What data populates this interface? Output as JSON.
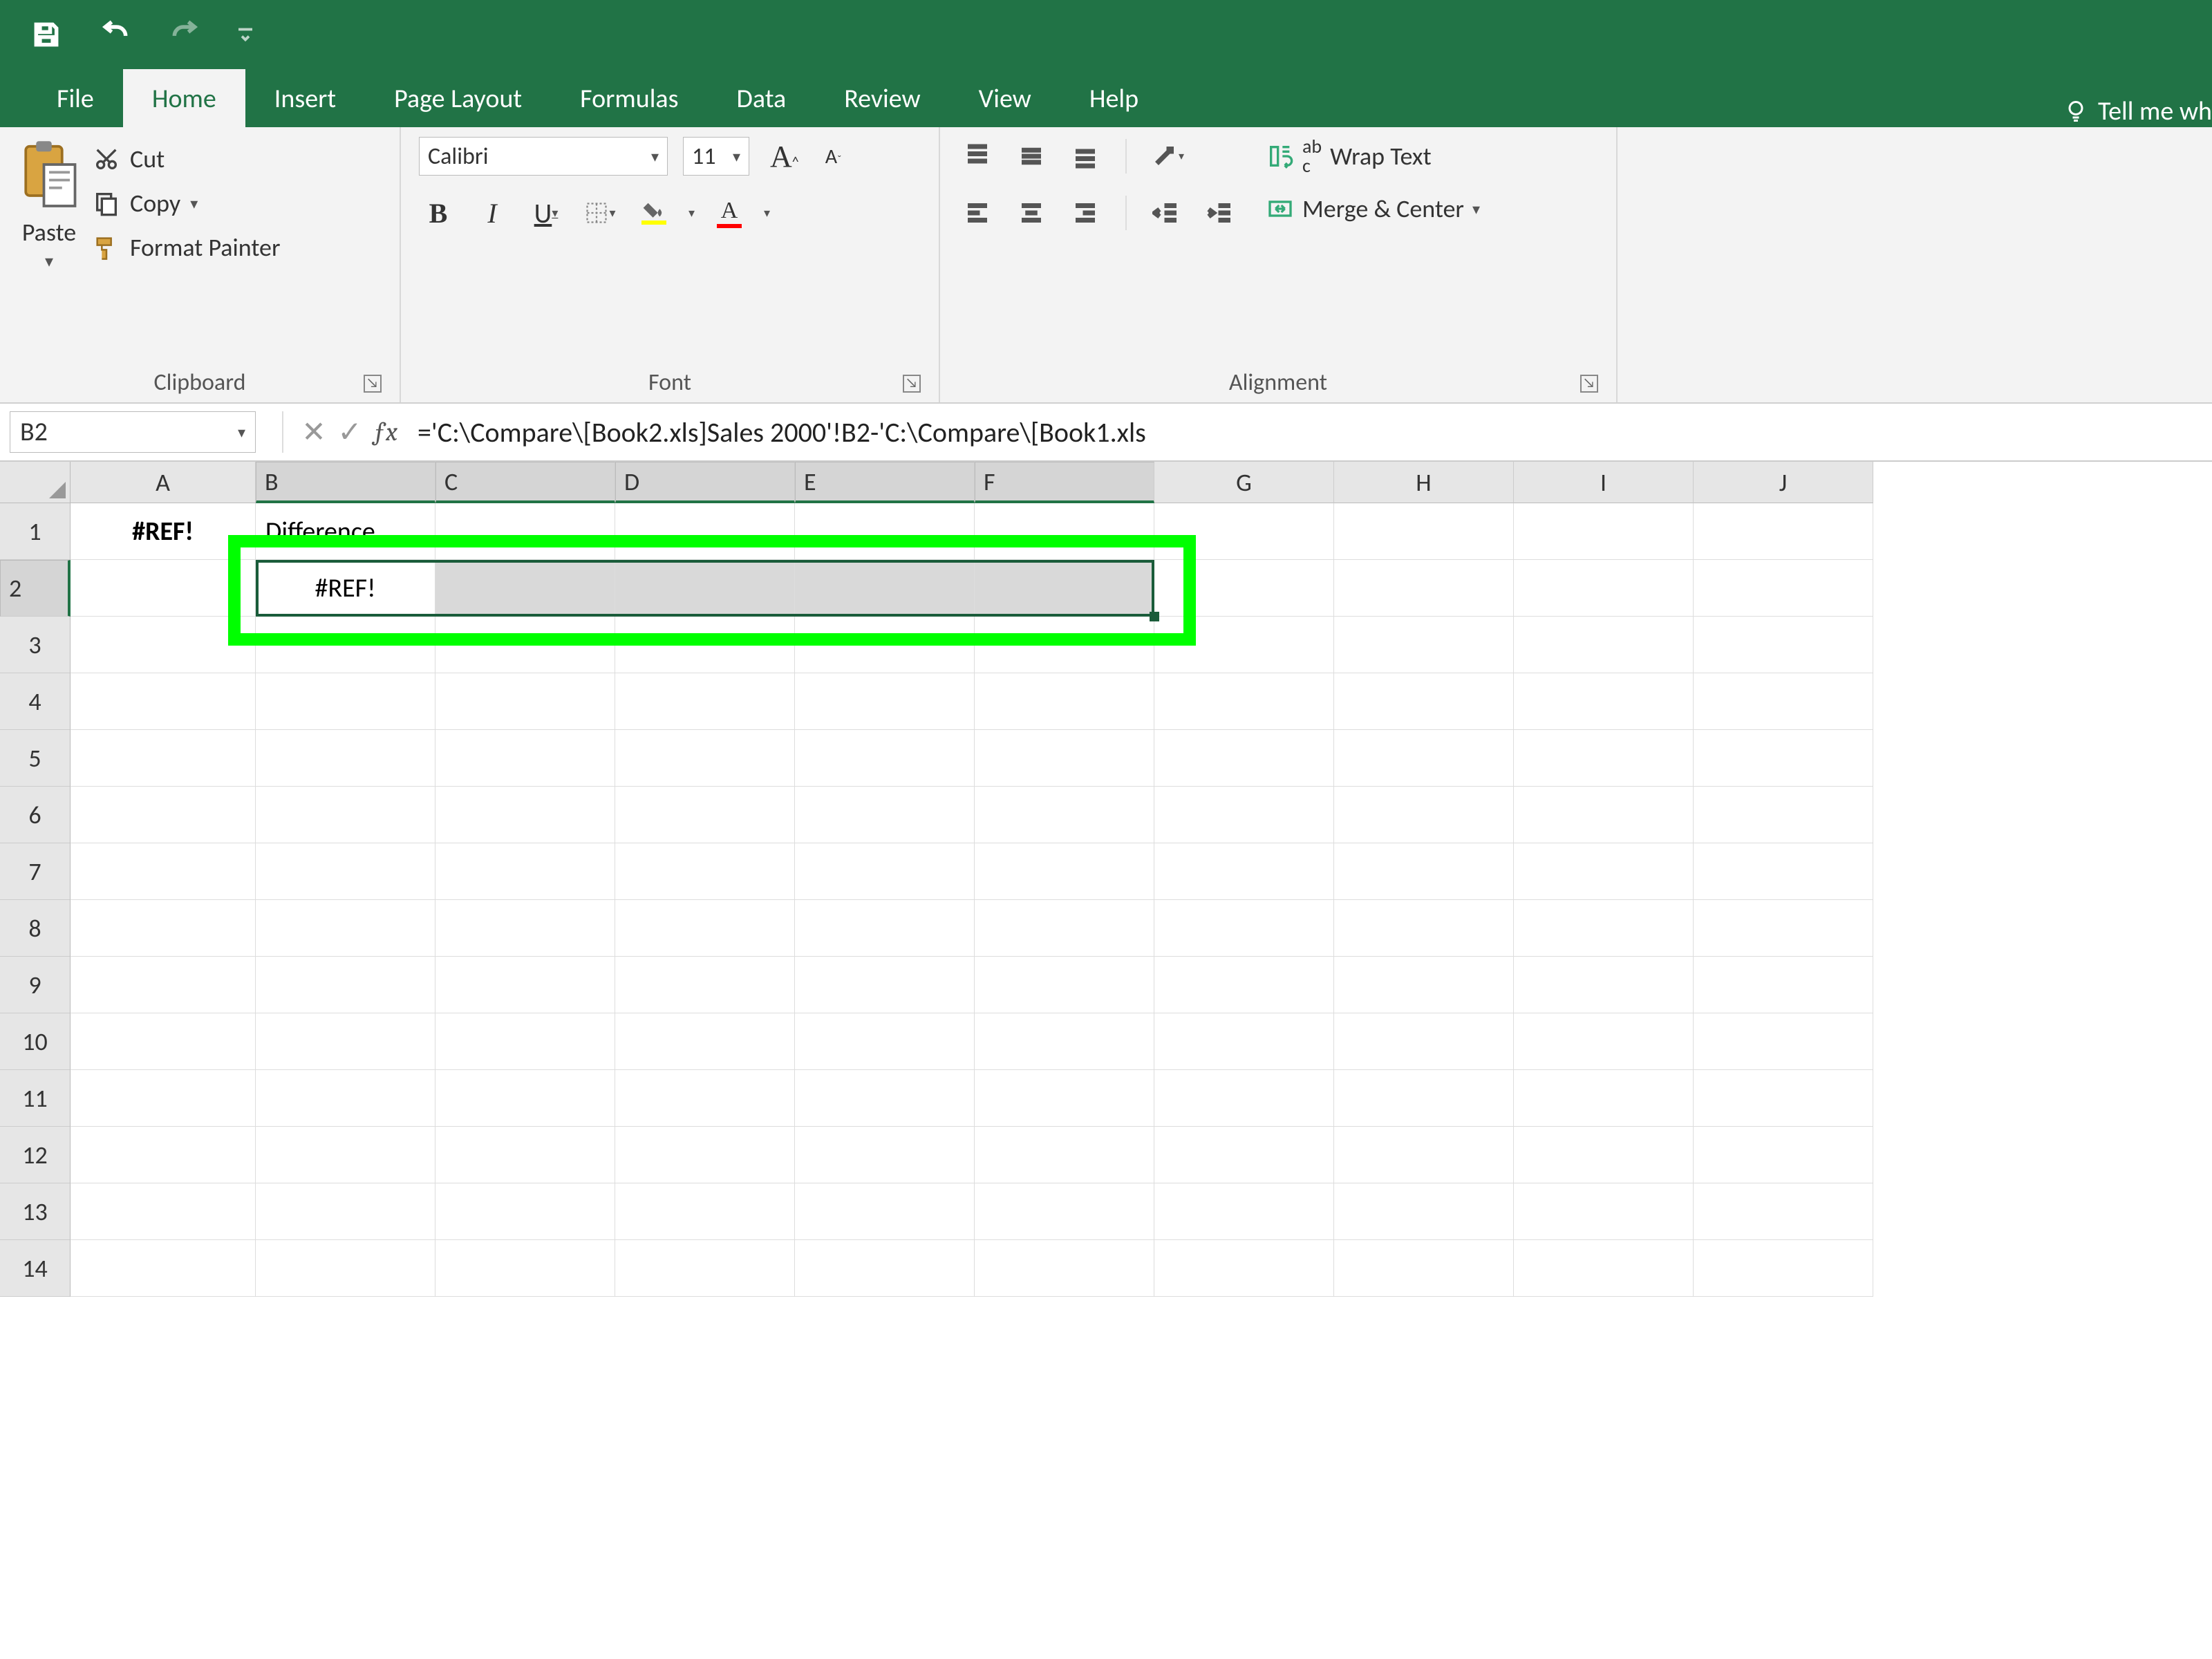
{
  "qat": {
    "save": "save",
    "undo": "undo",
    "redo": "redo"
  },
  "tabs": [
    "File",
    "Home",
    "Insert",
    "Page Layout",
    "Formulas",
    "Data",
    "Review",
    "View",
    "Help"
  ],
  "active_tab": "Home",
  "tellme": "Tell me wh",
  "ribbon": {
    "clipboard": {
      "paste": "Paste",
      "cut": "Cut",
      "copy": "Copy",
      "format_painter": "Format Painter",
      "label": "Clipboard"
    },
    "font": {
      "name": "Calibri",
      "size": "11",
      "bold": "B",
      "italic": "I",
      "underline": "U",
      "label": "Font"
    },
    "alignment": {
      "wrap": "Wrap Text",
      "merge": "Merge & Center",
      "label": "Alignment"
    }
  },
  "namebox": "B2",
  "formula": "='C:\\Compare\\[Book2.xls]Sales 2000'!B2-'C:\\Compare\\[Book1.xls",
  "columns": [
    "A",
    "B",
    "C",
    "D",
    "E",
    "F",
    "G",
    "H",
    "I",
    "J"
  ],
  "selected_cols": [
    "B",
    "C",
    "D",
    "E",
    "F"
  ],
  "rows": [
    "1",
    "2",
    "3",
    "4",
    "5",
    "6",
    "7",
    "8",
    "9",
    "10",
    "11",
    "12",
    "13",
    "14"
  ],
  "selected_row": "2",
  "cells": {
    "A1": "#REF!",
    "B1": "Difference",
    "B2": "#REF!"
  }
}
